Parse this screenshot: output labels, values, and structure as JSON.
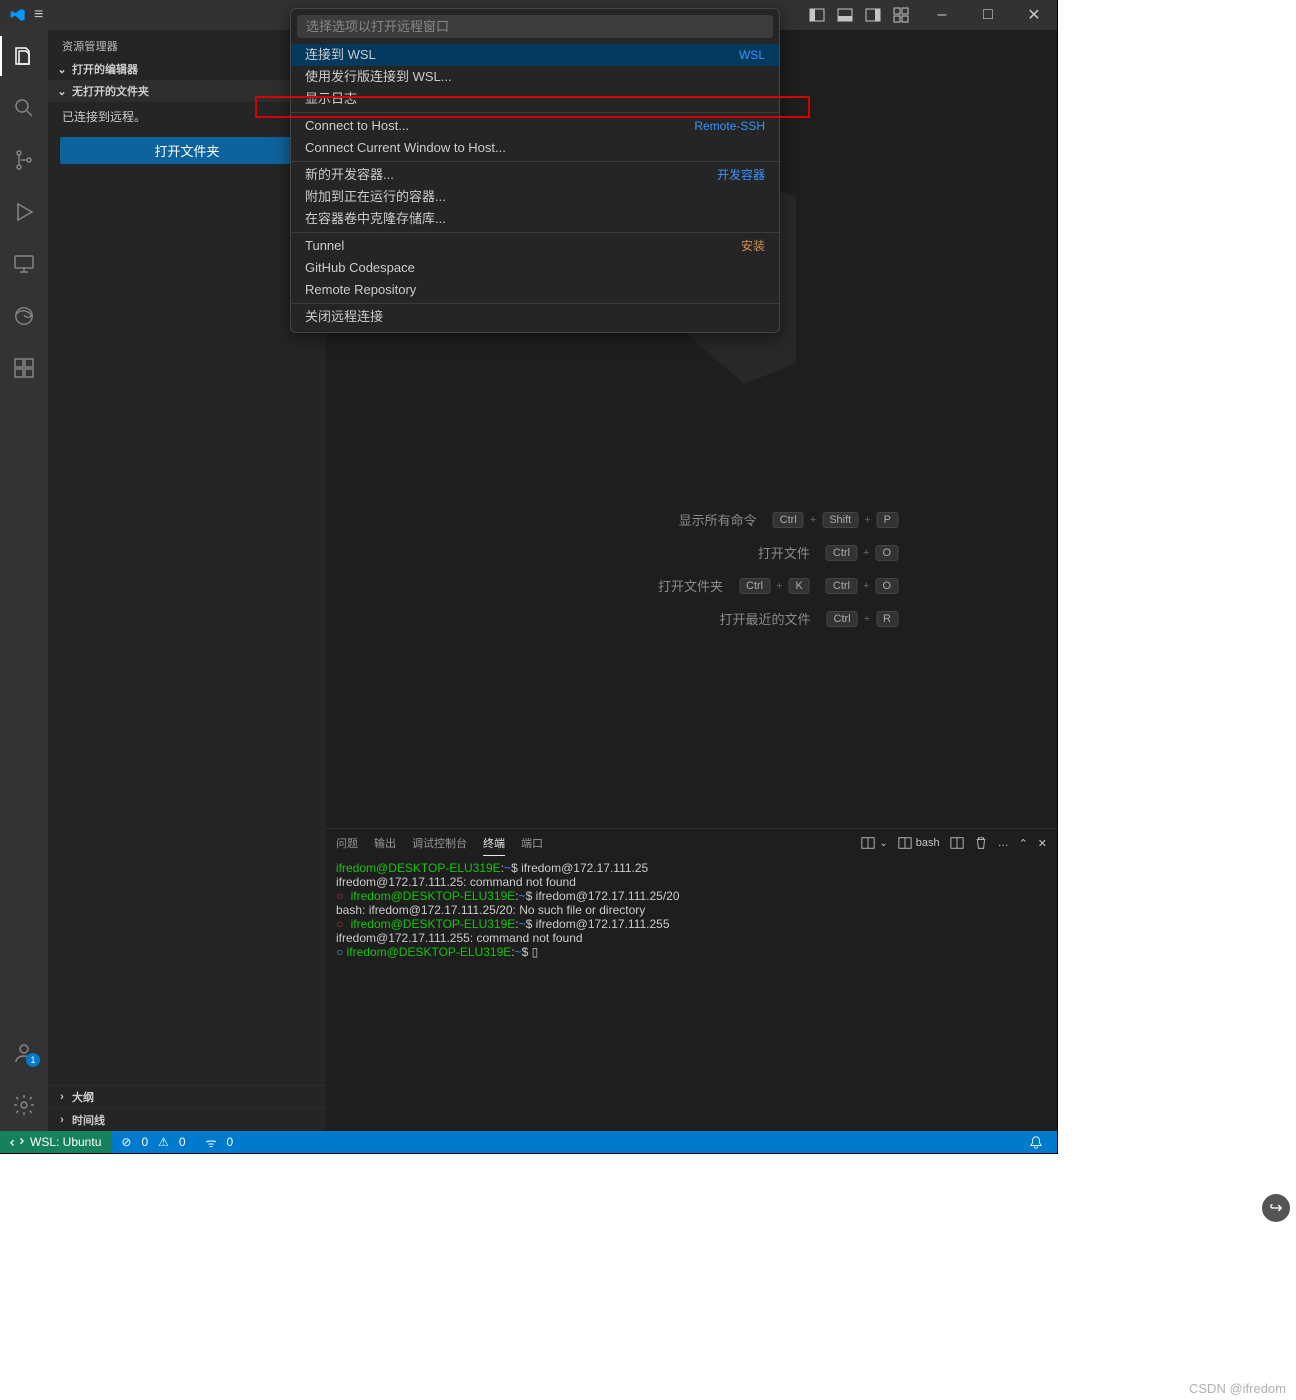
{
  "titlebar": {
    "minimize": "–",
    "maximize": "□",
    "close": "✕"
  },
  "palette": {
    "placeholder": "选择选项以打开远程窗口",
    "items": [
      {
        "label": "连接到 WSL",
        "tag": "WSL",
        "tag_color": ""
      },
      {
        "label": "使用发行版连接到 WSL...",
        "tag": ""
      },
      {
        "label": "显示日志",
        "tag": ""
      },
      {
        "label": "Connect to Host...",
        "tag": "Remote-SSH",
        "tag_color": ""
      },
      {
        "label": "Connect Current Window to Host...",
        "tag": ""
      },
      {
        "label": "新的开发容器...",
        "tag": "开发容器",
        "tag_color": ""
      },
      {
        "label": "附加到正在运行的容器...",
        "tag": ""
      },
      {
        "label": "在容器卷中克隆存储库...",
        "tag": ""
      },
      {
        "label": "Tunnel",
        "tag": "安装",
        "tag_color": "orange"
      },
      {
        "label": "GitHub Codespace",
        "tag": ""
      },
      {
        "label": "Remote Repository",
        "tag": ""
      },
      {
        "label": "关闭远程连接",
        "tag": ""
      }
    ]
  },
  "sidebar": {
    "title": "资源管理器",
    "sec_open_editors": "打开的编辑器",
    "sec_no_folder": "无打开的文件夹",
    "connected_text": "已连接到远程。",
    "open_folder_btn": "打开文件夹",
    "outline": "大纲",
    "timeline": "时间线"
  },
  "welcome": {
    "rows": [
      {
        "label": "显示所有命令",
        "keys": [
          "Ctrl",
          "Shift",
          "P"
        ]
      },
      {
        "label": "打开文件",
        "keys": [
          "Ctrl",
          "O"
        ]
      },
      {
        "label": "打开文件夹",
        "keys": [
          "Ctrl",
          "K"
        ],
        "keys2": [
          "Ctrl",
          "O"
        ]
      },
      {
        "label": "打开最近的文件",
        "keys": [
          "Ctrl",
          "R"
        ]
      }
    ]
  },
  "panel": {
    "tabs": {
      "problems": "问题",
      "output": "输出",
      "debug": "调试控制台",
      "terminal": "终端",
      "ports": "端口"
    },
    "right": {
      "bash": "bash",
      "more": "…"
    },
    "terminal_lines": [
      {
        "kind": "prompt",
        "user": "ifredom@DESKTOP-ELU319E",
        "sep": ":",
        "path": "~",
        "sym": "$ ",
        "cmd": "ifredom@172.17.111.25"
      },
      {
        "kind": "out",
        "text": "ifredom@172.17.111.25: command not found"
      },
      {
        "kind": "prompt",
        "dot": "red",
        "user": "ifredom@DESKTOP-ELU319E",
        "sep": ":",
        "path": "~",
        "sym": "$ ",
        "cmd": "ifredom@172.17.111.25/20"
      },
      {
        "kind": "out",
        "text": "bash: ifredom@172.17.111.25/20: No such file or directory"
      },
      {
        "kind": "prompt",
        "dot": "red",
        "user": "ifredom@DESKTOP-ELU319E",
        "sep": ":",
        "path": "~",
        "sym": "$ ",
        "cmd": "ifredom@172.17.111.255"
      },
      {
        "kind": "out",
        "text": "ifredom@172.17.111.255: command not found"
      },
      {
        "kind": "prompt",
        "dot": "cyan",
        "user": "ifredom@DESKTOP-ELU319E",
        "sep": ":",
        "path": "~",
        "sym": "$ ",
        "cmd": "▯"
      }
    ]
  },
  "status": {
    "remote": "WSL: Ubuntu",
    "errors": "0",
    "warnings": "0",
    "ports": "0"
  },
  "account_badge": "1",
  "csdn": "CSDN @ifredom"
}
